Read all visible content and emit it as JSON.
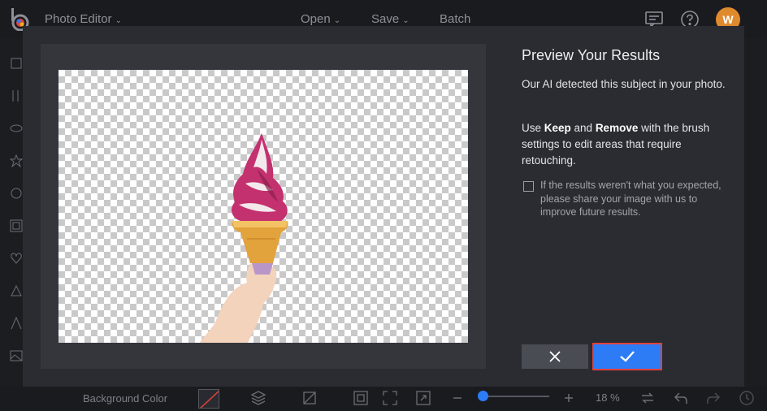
{
  "app": {
    "title": "Photo Editor",
    "menus": [
      "Open",
      "Save",
      "Batch"
    ],
    "avatar_initial": "W",
    "accent_color": "#2d7cf6",
    "avatar_color": "#e08a2e"
  },
  "icons": {
    "topbar": [
      "logo-icon",
      "feedback-icon",
      "help-icon"
    ],
    "left_rail": [
      "layers-icon",
      "adjust-icon",
      "eye-icon",
      "star-icon",
      "effects-icon",
      "frame-icon",
      "heart-icon",
      "shape-icon",
      "text-icon",
      "image-icon"
    ],
    "bottom": [
      "layers-stack-icon",
      "crop-icon",
      "fit-icon",
      "expand-icon",
      "zoom-out-icon",
      "zoom-in-icon",
      "compare-icon",
      "undo-icon",
      "redo-icon",
      "history-icon"
    ]
  },
  "bottom_bar": {
    "background_label": "Background Color",
    "zoom_level": "18 %",
    "zoom_fraction": 0.05
  },
  "modal": {
    "title": "Preview Your Results",
    "paragraph1": "Our AI detected this subject in your photo.",
    "paragraph2_prefix": "Use ",
    "keep_word": "Keep",
    "paragraph2_mid": " and ",
    "remove_word": "Remove",
    "paragraph2_suffix": " with the brush settings to edit areas that require retouching.",
    "feedback_text": "If the results weren't what you expected, please share your image with us to improve future results.",
    "feedback_checked": false,
    "cancel_icon": "close-icon",
    "confirm_icon": "check-icon"
  }
}
